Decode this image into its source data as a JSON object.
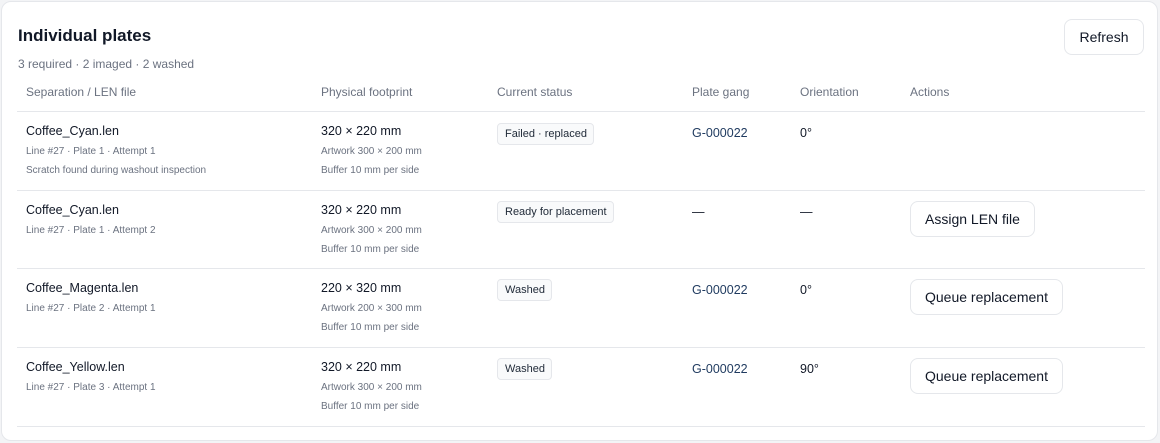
{
  "header": {
    "title": "Individual plates",
    "summary": "3 required · 2 imaged · 2 washed",
    "refresh_label": "Refresh"
  },
  "table": {
    "columns": [
      "Separation / LEN file",
      "Physical footprint",
      "Current status",
      "Plate gang",
      "Orientation",
      "Actions"
    ],
    "rows": [
      {
        "file": "Coffee_Cyan.len",
        "meta": "Line #27 · Plate 1 · Attempt 1",
        "note": "Scratch found during washout inspection",
        "footprint": "320 × 220 mm",
        "artwork": "Artwork 300 × 200 mm",
        "buffer": "Buffer 10 mm per side",
        "status": "Failed · replaced",
        "gang": "G-000022",
        "orientation": "0°",
        "action": ""
      },
      {
        "file": "Coffee_Cyan.len",
        "meta": "Line #27 · Plate 1 · Attempt 2",
        "note": "",
        "footprint": "320 × 220 mm",
        "artwork": "Artwork 300 × 200 mm",
        "buffer": "Buffer 10 mm per side",
        "status": "Ready for placement",
        "gang": "—",
        "orientation": "—",
        "action": "Assign LEN file"
      },
      {
        "file": "Coffee_Magenta.len",
        "meta": "Line #27 · Plate 2 · Attempt 1",
        "note": "",
        "footprint": "220 × 320 mm",
        "artwork": "Artwork 200 × 300 mm",
        "buffer": "Buffer 10 mm per side",
        "status": "Washed",
        "gang": "G-000022",
        "orientation": "0°",
        "action": "Queue replacement"
      },
      {
        "file": "Coffee_Yellow.len",
        "meta": "Line #27 · Plate 3 · Attempt 1",
        "note": "",
        "footprint": "320 × 220 mm",
        "artwork": "Artwork 300 × 200 mm",
        "buffer": "Buffer 10 mm per side",
        "status": "Washed",
        "gang": "G-000022",
        "orientation": "90°",
        "action": "Queue replacement"
      }
    ]
  }
}
